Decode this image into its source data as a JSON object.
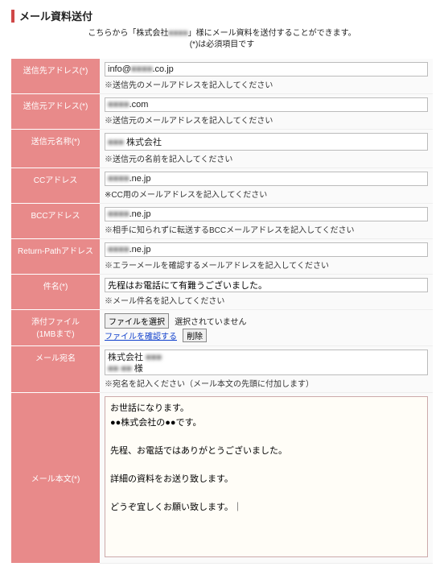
{
  "page": {
    "title": "メール資料送付",
    "intro_prefix": "こちらから「株式会社",
    "intro_company_masked": "■■■■",
    "intro_suffix": "」様にメール資料を送付することができます。",
    "required_note": "(*)は必須項目です"
  },
  "rows": {
    "to": {
      "label": "送信先アドレス(*)",
      "value_prefix": "info@",
      "value_masked": "■■■■",
      "value_suffix": ".co.jp",
      "hint": "※送信先のメールアドレスを記入してください"
    },
    "from": {
      "label": "送信元アドレス(*)",
      "value_masked": "■■■■",
      "value_suffix": ".com",
      "hint": "※送信元のメールアドレスを記入してください"
    },
    "from_name": {
      "label": "送信元名称(*)",
      "value_masked": "■■■",
      "value_suffix": " 株式会社",
      "hint": "※送信元の名前を記入してください"
    },
    "cc": {
      "label": "CCアドレス",
      "value_masked": "■■■■",
      "value_suffix": ".ne.jp",
      "hint": "※CC用のメールアドレスを記入してください"
    },
    "bcc": {
      "label": "BCCアドレス",
      "value_masked": "■■■■",
      "value_suffix": ".ne.jp",
      "hint": "※相手に知られずに転送するBCCメールアドレスを記入してください"
    },
    "return_path": {
      "label": "Return-Pathアドレス",
      "value_masked": "■■■■",
      "value_suffix": ".ne.jp",
      "hint": "※エラーメールを確認するメールアドレスを記入してください"
    },
    "subject": {
      "label": "件名(*)",
      "value": "先程はお電話にて有難うございました。",
      "hint": "※メール件名を記入してください"
    },
    "attachment": {
      "label": "添付ファイル\n(1MBまで)",
      "button": "ファイルを選択",
      "status": "選択されていません",
      "confirm_link": "ファイルを確認する",
      "delete_button": "削除"
    },
    "greeting": {
      "label": "メール宛名",
      "value_prefix": "株式会社 ",
      "value_masked": "■■■",
      "value_line2_masked": "■■ ■■",
      "value_line2_suffix": " 様",
      "hint": "※宛名を記入ください（メール本文の先頭に付加します）"
    },
    "body": {
      "label": "メール本文(*)",
      "text": "お世話になります。\n●●株式会社の●●です。\n\n先程、お電話ではありがとうございました。\n\n詳細の資料をお送り致します。\n\nどうぞ宜しくお願い致します。｜"
    }
  }
}
